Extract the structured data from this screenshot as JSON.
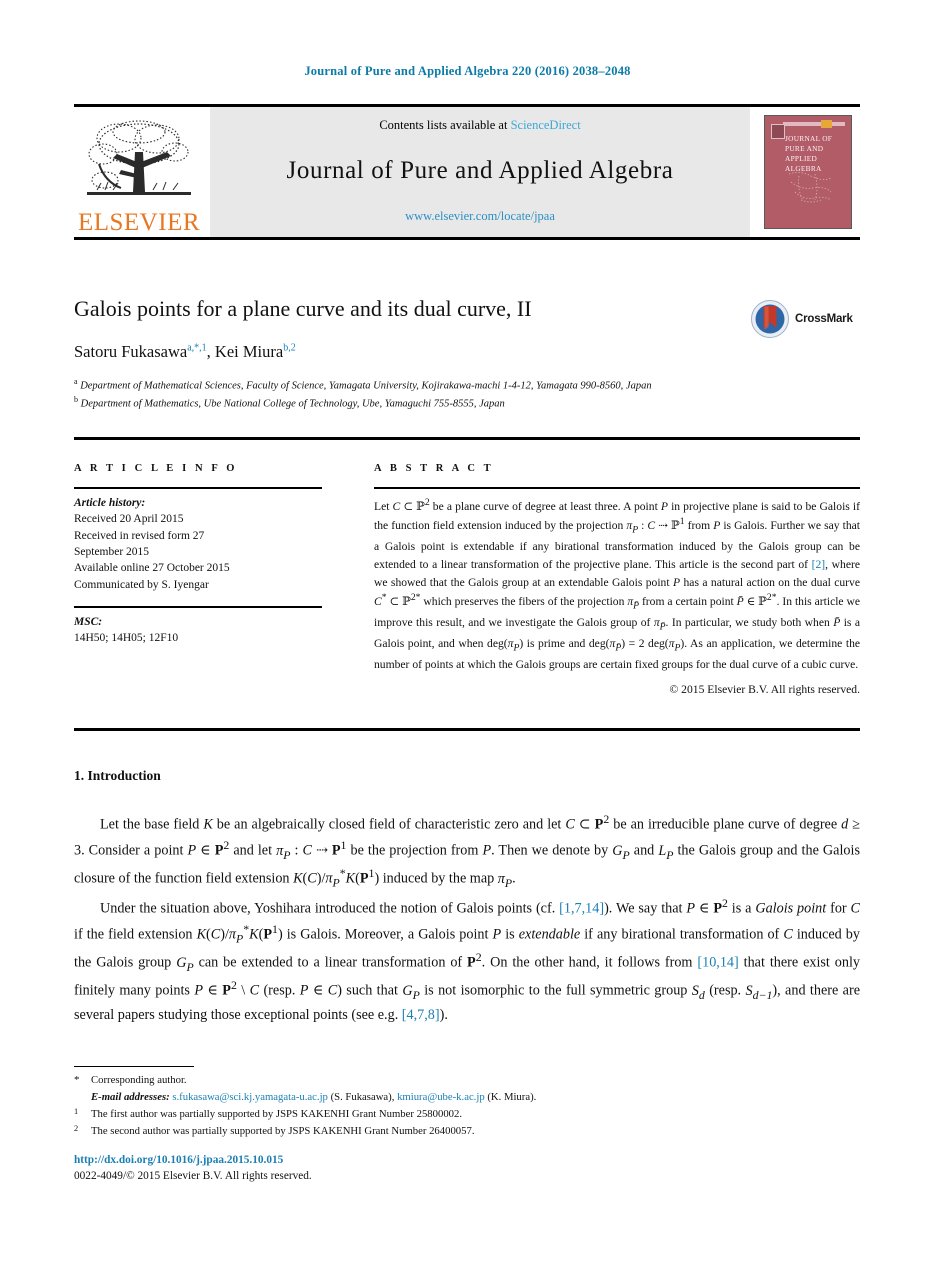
{
  "running_head": "Journal of Pure and Applied Algebra 220 (2016) 2038–2048",
  "masthead": {
    "publisher_name": "ELSEVIER",
    "contents_prefix": "Contents lists available at ",
    "contents_link": "ScienceDirect",
    "journal_title": "Journal of Pure and Applied Algebra",
    "journal_url": "www.elsevier.com/locate/jpaa",
    "cover_title": "JOURNAL OF PURE AND APPLIED ALGEBRA",
    "cover_color": "#b25c68"
  },
  "article": {
    "title": "Galois points for a plane curve and its dual curve, II",
    "crossmark_label": "CrossMark",
    "authors_html": "Satoru Fukasawa<sup>a,*,1</sup>, Kei Miura<sup>b,2</sup>",
    "affiliation_a": "Department of Mathematical Sciences, Faculty of Science, Yamagata University, Kojirakawa-machi 1-4-12, Yamagata 990-8560, Japan",
    "affiliation_b": "Department of Mathematics, Ube National College of Technology, Ube, Yamaguchi 755-8555, Japan"
  },
  "info": {
    "heading": "A R T I C L E   I N F O",
    "history_label": "Article history:",
    "history_lines": [
      "Received 20 April 2015",
      "Received in revised form 27",
      "September 2015",
      "Available online 27 October 2015",
      "Communicated by S. Iyengar"
    ],
    "msc_label": "MSC:",
    "msc_value": "14H50; 14H05; 12F10"
  },
  "abstract": {
    "heading": "A B S T R A C T",
    "body_html": "Let <i>C</i> ⊂ ℙ<sup>2</sup> be a plane curve of degree at least three. A point <i>P</i> in projective plane is said to be Galois if the function field extension induced by the projection <i>π<sub>P</sub></i> : <i>C</i> ⇢ ℙ<sup>1</sup> from <i>P</i> is Galois. Further we say that a Galois point is extendable if any birational transformation induced by the Galois group can be extended to a linear transformation of the projective plane. This article is the second part of <span class=\"ref\">[2]</span>, where we showed that the Galois group at an extendable Galois point <i>P</i> has a natural action on the dual curve <i>C</i><sup>*</sup> ⊂ ℙ<sup>2*</sup> which preserves the fibers of the projection <i>π<sub>P̄</sub></i> from a certain point <i>P̄</i> ∈ ℙ<sup>2*</sup>. In this article we improve this result, and we investigate the Galois group of <i>π<sub>P̄</sub></i>. In particular, we study both when <i>P̄</i> is a Galois point, and when deg(<i>π<sub>P</sub></i>) is prime and deg(<i>π<sub>P̄</sub></i>) = 2 deg(<i>π<sub>P</sub></i>). As an application, we determine the number of points at which the Galois groups are certain fixed groups for the dual curve of a cubic curve.",
    "copyright": "© 2015 Elsevier B.V. All rights reserved."
  },
  "body": {
    "section_heading": "1. Introduction",
    "paragraph1_html": "Let the base field <i>K</i> be an algebraically closed field of characteristic zero and let <i>C</i> ⊂ <b>P</b><sup>2</sup> be an irreducible plane curve of degree <i>d</i> ≥ 3. Consider a point <i>P</i> ∈ <b>P</b><sup>2</sup> and let <i>π<sub>P</sub></i> : <i>C</i> ⇢ <b>P</b><sup>1</sup> be the projection from <i>P</i>. Then we denote by <i>G<sub>P</sub></i> and <i>L<sub>P</sub></i> the Galois group and the Galois closure of the function field extension <i>K</i>(<i>C</i>)/<i>π</i><sub><i>P</i></sub><sup>*</sup><i>K</i>(<b>P</b><sup>1</sup>) induced by the map <i>π<sub>P</sub></i>.",
    "paragraph2_html": "Under the situation above, Yoshihara introduced the notion of Galois points (cf. <span class=\"ref\">[1,7,14]</span>). We say that <i>P</i> ∈ <b>P</b><sup>2</sup> is a <i>Galois point</i> for <i>C</i> if the field extension <i>K</i>(<i>C</i>)/<i>π</i><sub><i>P</i></sub><sup>*</sup><i>K</i>(<b>P</b><sup>1</sup>) is Galois. Moreover, a Galois point <i>P</i> is <i>extendable</i> if any birational transformation of <i>C</i> induced by the Galois group <i>G<sub>P</sub></i> can be extended to a linear transformation of <b>P</b><sup>2</sup>. On the other hand, it follows from <span class=\"ref\">[10,14]</span> that there exist only finitely many points <i>P</i> ∈ <b>P</b><sup>2</sup> \\ <i>C</i> (resp. <i>P</i> ∈ <i>C</i>) such that <i>G<sub>P</sub></i> is not isomorphic to the full symmetric group <i>S<sub>d</sub></i> (resp. <i>S<sub>d−1</sub></i>), and there are several papers studying those exceptional points (see e.g. <span class=\"ref\">[4,7,8]</span>)."
  },
  "footnotes": [
    {
      "mark": "*",
      "text_html": "Corresponding author."
    },
    {
      "mark": "",
      "text_html": "<span class=\"lbl\">E-mail addresses:</span> <span class=\"link\">s.fukasawa@sci.kj.yamagata-u.ac.jp</span> (S. Fukasawa), <span class=\"link\">kmiura@ube-k.ac.jp</span> (K. Miura)."
    },
    {
      "mark": "1",
      "text_html": "The first author was partially supported by JSPS KAKENHI Grant Number 25800002."
    },
    {
      "mark": "2",
      "text_html": "The second author was partially supported by JSPS KAKENHI Grant Number 26400057."
    }
  ],
  "footer": {
    "doi": "http://dx.doi.org/10.1016/j.jpaa.2015.10.015",
    "issn_line": "0022-4049/© 2015 Elsevier B.V. All rights reserved."
  },
  "colors": {
    "link": "#1a7fb3",
    "running_head": "#0b7ba8",
    "elsevier_orange": "#E87722",
    "panel_grey": "#e8e8e8"
  }
}
